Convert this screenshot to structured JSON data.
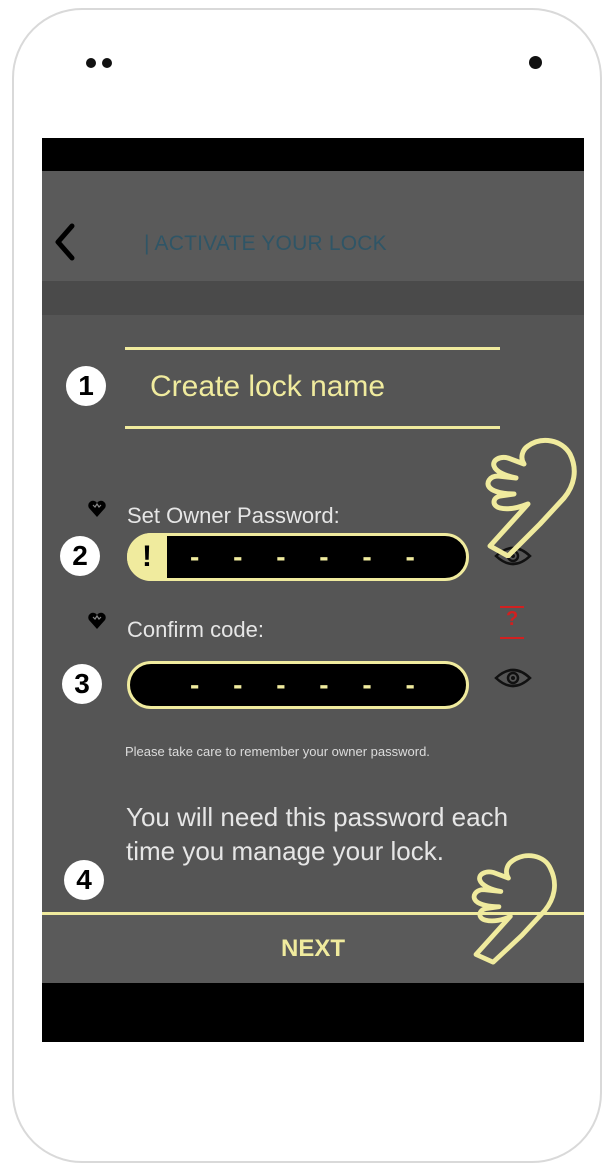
{
  "header": {
    "title": "| ACTIVATE YOUR LOCK"
  },
  "steps": {
    "one": "1",
    "two": "2",
    "three": "3",
    "four": "4"
  },
  "lock_name": {
    "placeholder": "Create lock name"
  },
  "owner_password": {
    "label": "Set Owner Password:",
    "value": "- - - - - -",
    "warning": "!"
  },
  "confirm_code": {
    "label": "Confirm code:",
    "value": "- - - - - -",
    "help": "?"
  },
  "notes": {
    "small": "Please take care to remember your owner password.",
    "large": "You will need this password each time you manage your lock."
  },
  "footer": {
    "next_label": "NEXT"
  },
  "colors": {
    "accent": "#f0eb9e",
    "screen_bg": "#555555",
    "title": "#2f5566",
    "help": "#d12020"
  },
  "icons": [
    "back-chevron-icon",
    "heart-icon",
    "eye-icon",
    "help-icon",
    "pointing-hand-icon"
  ]
}
